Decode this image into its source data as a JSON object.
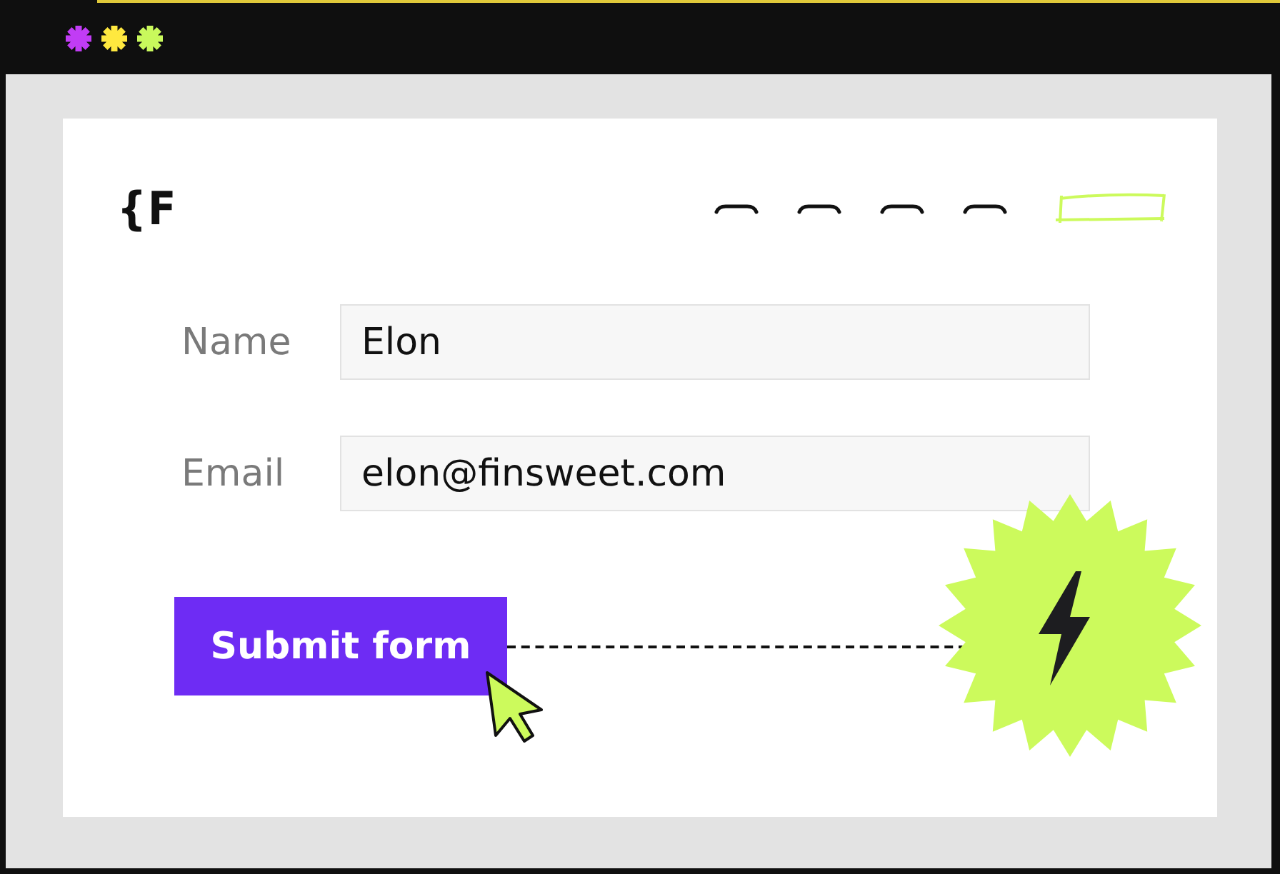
{
  "window": {
    "controls": [
      {
        "color": "#c13cf5"
      },
      {
        "color": "#ffe83f"
      },
      {
        "color": "#c9f95c"
      }
    ]
  },
  "logo": {
    "text": "{F"
  },
  "form": {
    "fields": [
      {
        "label": "Name",
        "value": "Elon"
      },
      {
        "label": "Email",
        "value": "elon@finsweet.com"
      }
    ],
    "submit": {
      "label": "Submit form"
    }
  }
}
